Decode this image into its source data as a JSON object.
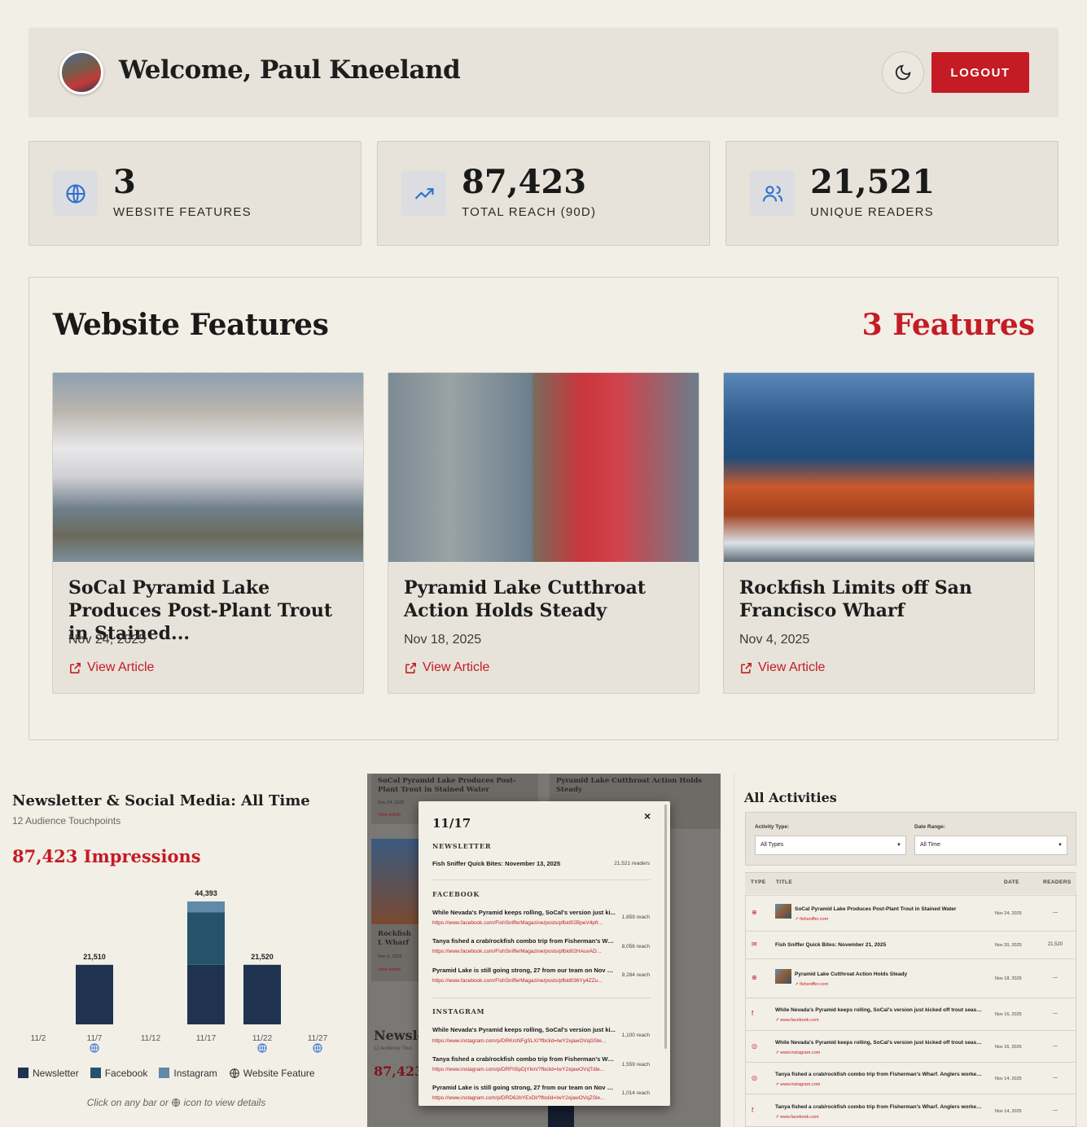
{
  "header": {
    "welcome": "Welcome, Paul Kneeland",
    "logout_label": "LOGOUT"
  },
  "stats": [
    {
      "value": "3",
      "label": "WEBSITE FEATURES",
      "icon": "globe-icon"
    },
    {
      "value": "87,423",
      "label": "TOTAL REACH (90D)",
      "icon": "trending-up-icon"
    },
    {
      "value": "21,521",
      "label": "UNIQUE READERS",
      "icon": "users-icon"
    }
  ],
  "features": {
    "title": "Website Features",
    "count_label": "3 Features",
    "cards": [
      {
        "title": "SoCal Pyramid Lake Produces Post-Plant Trout in Stained...",
        "date": "Nov 24, 2025",
        "link": "View Article"
      },
      {
        "title": "Pyramid Lake Cutthroat Action Holds Steady",
        "date": "Nov 18, 2025",
        "link": "View Article"
      },
      {
        "title": "Rockfish Limits off San Francisco Wharf",
        "date": "Nov 4, 2025",
        "link": "View Article"
      }
    ]
  },
  "newsletter_panel": {
    "title": "Newsletter & Social Media: All Time",
    "subtitle": "12 Audience Touchpoints",
    "impressions": "87,423 Impressions",
    "legend": [
      "Newsletter",
      "Facebook",
      "Instagram",
      "Website Feature"
    ],
    "hint_before": "Click on any bar or",
    "hint_after": "icon to view details"
  },
  "chart_data": {
    "type": "bar",
    "stacked": true,
    "categories": [
      "11/2",
      "11/7",
      "11/12",
      "11/17",
      "11/22",
      "11/27"
    ],
    "series": [
      {
        "name": "Newsletter",
        "values": [
          0,
          21510,
          0,
          21521,
          21520,
          0
        ]
      },
      {
        "name": "Facebook",
        "values": [
          0,
          0,
          0,
          18904,
          0,
          0
        ]
      },
      {
        "name": "Instagram",
        "values": [
          0,
          0,
          0,
          3968,
          0,
          0
        ]
      }
    ],
    "totals": [
      "",
      "21,510",
      "",
      "44,393",
      "21,520",
      ""
    ],
    "website_feature_markers": [
      "11/7",
      "11/22",
      "11/27"
    ],
    "ylim": [
      0,
      44393
    ],
    "colors": {
      "Newsletter": "#1f3350",
      "Facebook": "#26536b",
      "Instagram": "#5f8aa8"
    }
  },
  "modal": {
    "date": "11/17",
    "close": "×",
    "newsletter_label": "NEWSLETTER",
    "newsletter_item": {
      "title": "Fish Sniffer Quick Bites: November 13, 2025",
      "reach": "21,521 readers"
    },
    "facebook_label": "FACEBOOK",
    "facebook_items": [
      {
        "title": "While Nevada's Pyramid keeps rolling, SoCal's version just ki...",
        "url": "https://www.facebook.com/FishSnifferMagazine/posts/pfbid02BpeV4pfr...",
        "reach": "1,859 reach"
      },
      {
        "title": "Tanya fished a crab/rockfish combo trip from Fisherman's Wh...",
        "url": "https://www.facebook.com/FishSnifferMagazine/posts/pfbid02HAuvAD...",
        "reach": "8,056 reach"
      },
      {
        "title": "Pyramid Lake is still going strong, 27 from our team on Nov 1...",
        "url": "https://www.facebook.com/FishSnifferMagazine/posts/pfbid036Yy4ZZu...",
        "reach": "9,284 reach"
      }
    ],
    "instagram_label": "INSTAGRAM",
    "instagram_items": [
      {
        "title": "While Nevada's Pyramid keeps rolling, SoCal's version just ki...",
        "url": "https://www.instagram.com/p/DRKrcNFgSLX/?fbclid=IwY2xjawOVqGSle...",
        "reach": "1,100 reach"
      },
      {
        "title": "Tanya fished a crab/rockfish combo trip from Fisherman's Wh...",
        "url": "https://www.instagram.com/p/DRFh5pDjYkm/?fbclid=IwY2xjawOVqTdle...",
        "reach": "1,559 reach"
      },
      {
        "title": "Pyramid Lake is still going strong, 27 from our team on Nov 1...",
        "url": "https://www.instagram.com/p/DRD62bYExDl/?fbclid=IwY2xjawOVqZSle...",
        "reach": "1,014 reach"
      }
    ],
    "bg_card1": "SoCal Pyramid Lake Produces Post-Plant Trout in Stained Water",
    "bg_card1_date": "Nov 24, 2025",
    "bg_card2": "Pyramid Lake Cutthroat Action Holds Steady",
    "bg_card3": "Rockfish L Wharf",
    "bg_card3_date": "Nov 4, 2025",
    "bg_view": "View Article",
    "bg_news": "Newsle",
    "bg_sub": "12 Audience Touc",
    "bg_imp": "87,423"
  },
  "activities": {
    "title": "All Activities",
    "type_label": "Activity Type:",
    "type_value": "All Types",
    "range_label": "Date Range:",
    "range_value": "All Time",
    "headers": [
      "TYPE",
      "TITLE",
      "DATE",
      "READERS"
    ],
    "rows": [
      {
        "icon": "globe-icon",
        "title": "SoCal Pyramid Lake Produces Post-Plant Trout in Stained Water",
        "link": "fishsniffer.com",
        "date": "Nov 24, 2025",
        "readers": "—",
        "thumb": true
      },
      {
        "icon": "mail-icon",
        "title": "Fish Sniffer Quick Bites: November 21, 2025",
        "link": "",
        "date": "Nov 20, 2025",
        "readers": "21,520",
        "thumb": false
      },
      {
        "icon": "globe-icon",
        "title": "Pyramid Lake Cutthroat Action Holds Steady",
        "link": "fishsniffer.com",
        "date": "Nov 18, 2025",
        "readers": "—",
        "thumb": true
      },
      {
        "icon": "facebook-icon",
        "title": "While Nevada's Pyramid keeps rolling, SoCal's version just kicked off trout season ...",
        "link": "www.facebook.com",
        "date": "Nov 16, 2025",
        "readers": "—",
        "thumb": false
      },
      {
        "icon": "instagram-icon",
        "title": "While Nevada's Pyramid keeps rolling, SoCal's version just kicked off trout season ...",
        "link": "www.instagram.com",
        "date": "Nov 16, 2025",
        "readers": "—",
        "thumb": false
      },
      {
        "icon": "instagram-icon",
        "title": "Tanya fished a crab/rockfish combo trip from Fisherman's Wharf. Anglers worked ...",
        "link": "www.instagram.com",
        "date": "Nov 14, 2025",
        "readers": "—",
        "thumb": false
      },
      {
        "icon": "facebook-icon",
        "title": "Tanya fished a crab/rockfish combo trip from Fisherman's Wharf. Anglers worked ...",
        "link": "www.facebook.com",
        "date": "Nov 14, 2025",
        "readers": "—",
        "thumb": false
      }
    ]
  },
  "colors": {
    "accent": "#c41b24",
    "background": "#f2efe7",
    "card": "#e7e3da"
  }
}
